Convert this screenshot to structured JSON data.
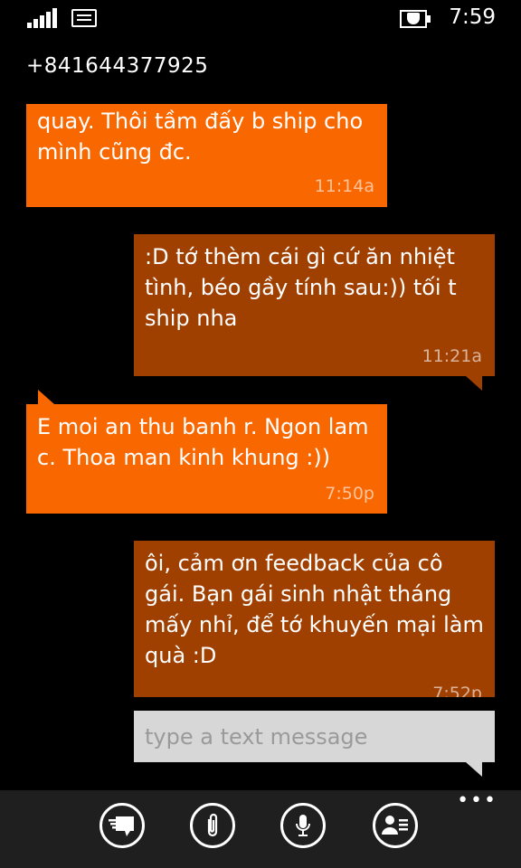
{
  "status_bar": {
    "time": "7:59"
  },
  "header": {
    "contact": "+841644377925"
  },
  "messages": [
    {
      "direction": "in",
      "text": "quay. Thôi tầm đấy b ship cho mình cũng đc.",
      "time": "11:14a"
    },
    {
      "direction": "out",
      "text": ":D tớ thèm cái gì cứ ăn nhiệt tình, béo gầy tính sau:)) tối t ship nha",
      "time": "11:21a"
    },
    {
      "direction": "in",
      "text": "E moi an thu banh r. Ngon lam c. Thoa man kinh khung :))",
      "time": "7:50p"
    },
    {
      "direction": "out",
      "text": "ôi, cảm ơn feedback của cô gái. Bạn gái sinh nhật tháng mấy nhỉ, để tớ khuyến mại làm quà :D",
      "time": "7:52p"
    }
  ],
  "composer": {
    "placeholder": "type a text message"
  },
  "app_bar": {
    "more_label": "•••",
    "buttons": [
      "switch-conversation-icon",
      "attach-icon",
      "voice-icon",
      "contact-card-icon"
    ]
  },
  "colors": {
    "incoming": "#f96800",
    "outgoing": "#a04000",
    "input": "#d7d7d7",
    "app_bar": "#1f1f1f"
  }
}
